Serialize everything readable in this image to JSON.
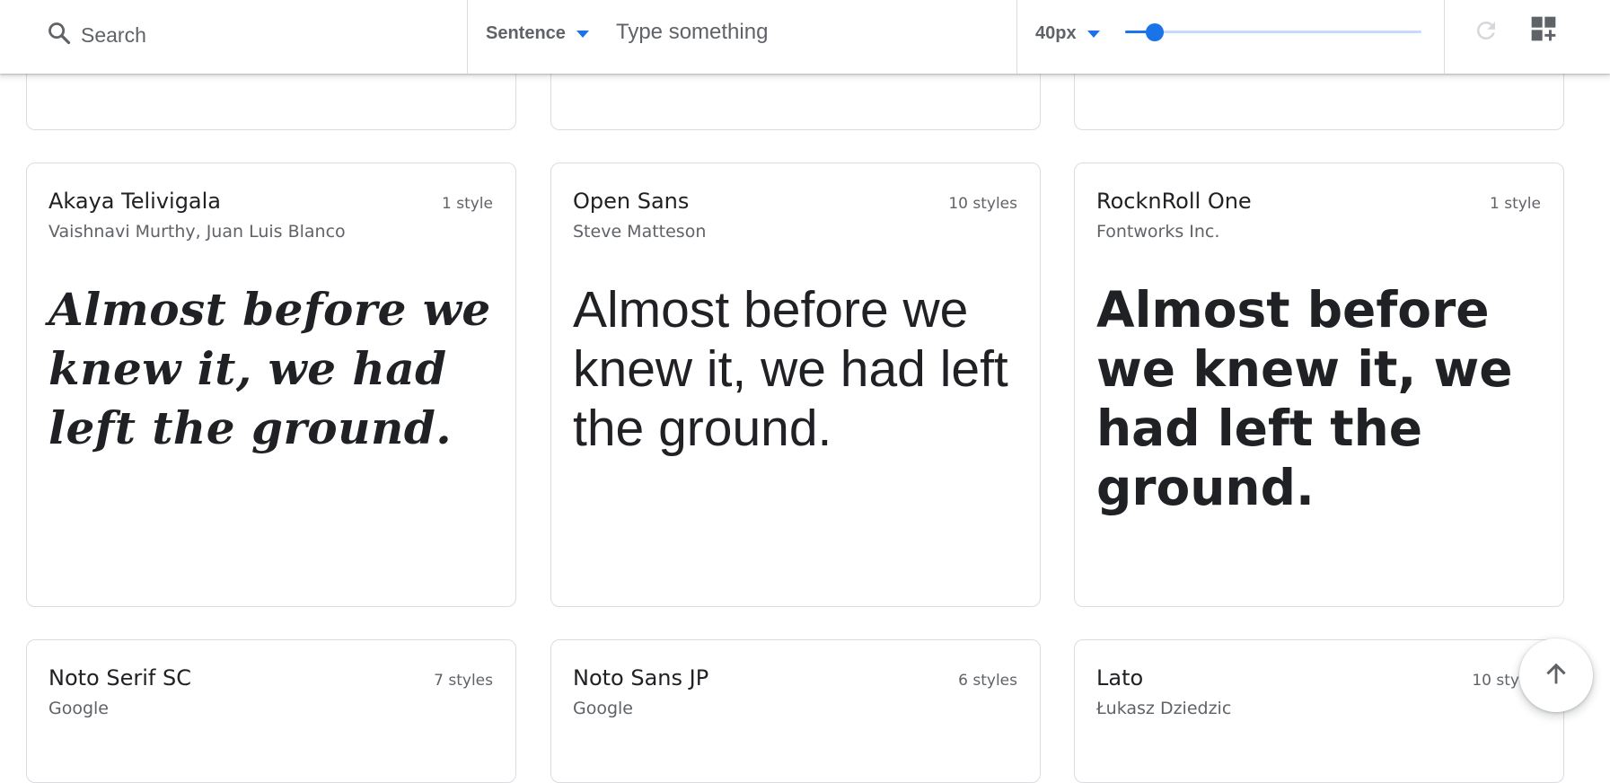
{
  "toolbar": {
    "search_placeholder": "Search",
    "preview_mode": "Sentence",
    "preview_text_placeholder": "Type something",
    "font_size_label": "40px",
    "font_size_slider_level": 0.1,
    "icons": {
      "search": "search-icon",
      "mode_dropdown": "caret-down-icon",
      "size_dropdown": "caret-down-icon",
      "reset": "refresh-icon",
      "grid": "add-to-grid-icon"
    },
    "accent_color": "#1a73e8"
  },
  "sample_sentence": "Almost before we knew it, we had left the ground.",
  "fonts": [
    {
      "name": "Akaya Telivigala",
      "styles": "1 style",
      "designer": "Vaishnavi Murthy, Juan Luis Blanco",
      "preview": "Almost before we knew it, we had left the ground."
    },
    {
      "name": "Open Sans",
      "styles": "10 styles",
      "designer": "Steve Matteson",
      "preview": "Almost before we knew it, we had left the ground."
    },
    {
      "name": "RocknRoll One",
      "styles": "1 style",
      "designer": "Fontworks Inc.",
      "preview": "Almost before we knew it, we had left the ground."
    },
    {
      "name": "Noto Serif SC",
      "styles": "7 styles",
      "designer": "Google"
    },
    {
      "name": "Noto Sans JP",
      "styles": "6 styles",
      "designer": "Google"
    },
    {
      "name": "Lato",
      "styles": "10 styles",
      "designer": "Łukasz Dziedzic"
    }
  ],
  "back_to_top": {
    "icon": "arrow-up-icon"
  }
}
